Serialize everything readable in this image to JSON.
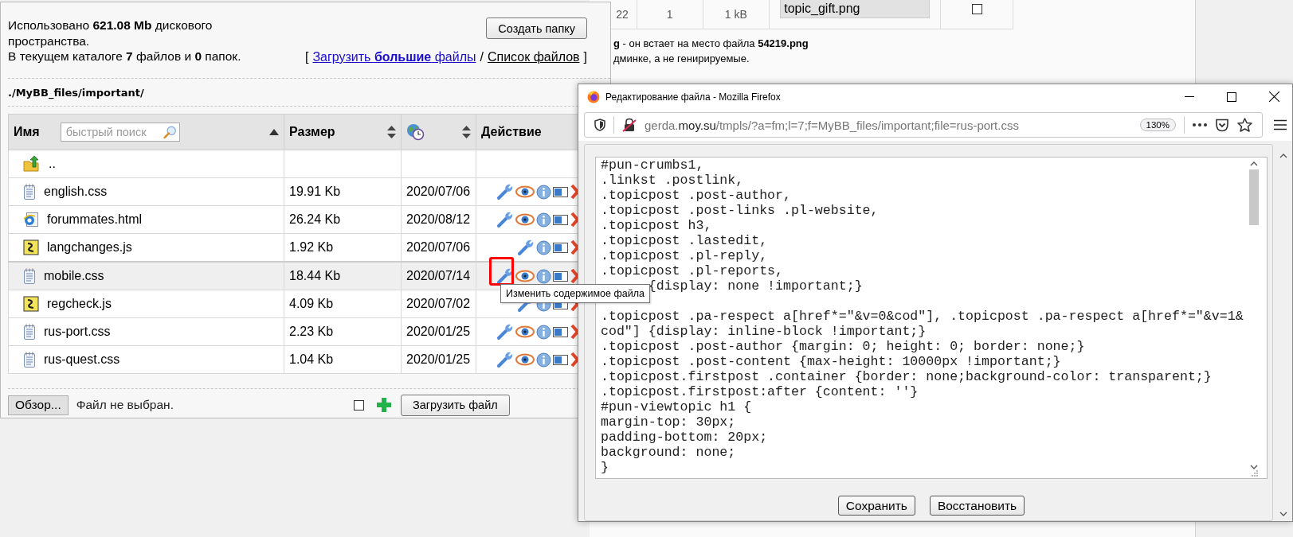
{
  "background_page": {
    "table_row": {
      "cells": [
        "22",
        "1",
        "1 kB",
        "topic_gift.png"
      ],
      "checked": false
    },
    "notes": [
      "**g** - он встает на место файла **54219.png**",
      "дминке, а не генирируемые."
    ]
  },
  "file_manager": {
    "usage": "Использовано **621.08 Mb** дискового пространства.",
    "counts": "В текущем каталоге **7** файлов и **0** папок.",
    "create_folder_button": "Создать папку",
    "links": {
      "open": "[",
      "upload_large": "Загрузить **большие** файлы",
      "separator": "/",
      "file_list": "Список файлов",
      "close": "]"
    },
    "path": "./MyBB_files/important/",
    "table": {
      "search": {
        "placeholder": "быстрый поиск"
      },
      "columns": [
        {
          "kind": "name",
          "label": "Имя"
        },
        {
          "kind": "sortable",
          "label": "Размер"
        },
        {
          "kind": "date"
        },
        {
          "kind": "plain",
          "label": "Действие"
        }
      ],
      "rows": [
        {
          "kind": "parent",
          "name": ".."
        },
        {
          "kind": "stylesheet",
          "name": "english.css",
          "size": "19.91 Kb",
          "date": "2020/07/06",
          "viewable": true,
          "highlighted": false
        },
        {
          "kind": "webpage",
          "name": "forummates.html",
          "size": "26.24 Kb",
          "date": "2020/08/12",
          "viewable": true,
          "highlighted": false
        },
        {
          "kind": "script",
          "name": "langchanges.js",
          "size": "1.92 Kb",
          "date": "2020/07/06",
          "viewable": false,
          "highlighted": false
        },
        {
          "kind": "stylesheet",
          "name": "mobile.css",
          "size": "18.44 Kb",
          "date": "2020/07/14",
          "viewable": true,
          "highlighted": true
        },
        {
          "kind": "script",
          "name": "regcheck.js",
          "size": "4.09 Kb",
          "date": "2020/07/02",
          "viewable": false,
          "highlighted": false
        },
        {
          "kind": "stylesheet",
          "name": "rus-port.css",
          "size": "2.23 Kb",
          "date": "2020/01/25",
          "viewable": true,
          "highlighted": false
        },
        {
          "kind": "stylesheet",
          "name": "rus-quest.css",
          "size": "1.04 Kb",
          "date": "2020/01/25",
          "viewable": true,
          "highlighted": false
        }
      ]
    },
    "upload": {
      "browse_button": "Обзор...",
      "status": "Файл не выбран.",
      "checked": false,
      "upload_button": "Загрузить файл"
    },
    "tooltip": "Изменить содержимое файла"
  },
  "browser": {
    "title": "Редактирование файла - Mozilla Firefox",
    "url": {
      "prefix": "gerda.",
      "domain": "moy.su",
      "path": "/tmpls/?a=fm;l=7;f=MyBB_files/important;file=rus-port.css"
    },
    "zoom": "130%",
    "editor_text": "#pun-crumbs1,\n.linkst .postlink,\n.topicpost .post-author,\n.topicpost .post-links .pl-website,\n.topicpost h3,\n.topicpost .lastedit,\n.topicpost .pl-reply,\n.topicpost .pl-reports,\n      {display: none !important;}\n\n.topicpost .pa-respect a[href*=\"&v=0&cod\"], .topicpost .pa-respect a[href*=\"&v=1&cod\"] {display: inline-block !important;}\n.topicpost .post-author {margin: 0; height: 0; border: none;}\n.topicpost .post-content {max-height: 10000px !important;}\n.topicpost.firstpost .container {border: none;background-color: transparent;}\n.topicpost.firstpost:after {content: ''}\n#pun-viewtopic h1 {\nmargin-top: 30px;\npadding-bottom: 20px;\nbackground: none;\n}",
    "buttons": [
      "Сохранить",
      "Восстановить"
    ]
  }
}
